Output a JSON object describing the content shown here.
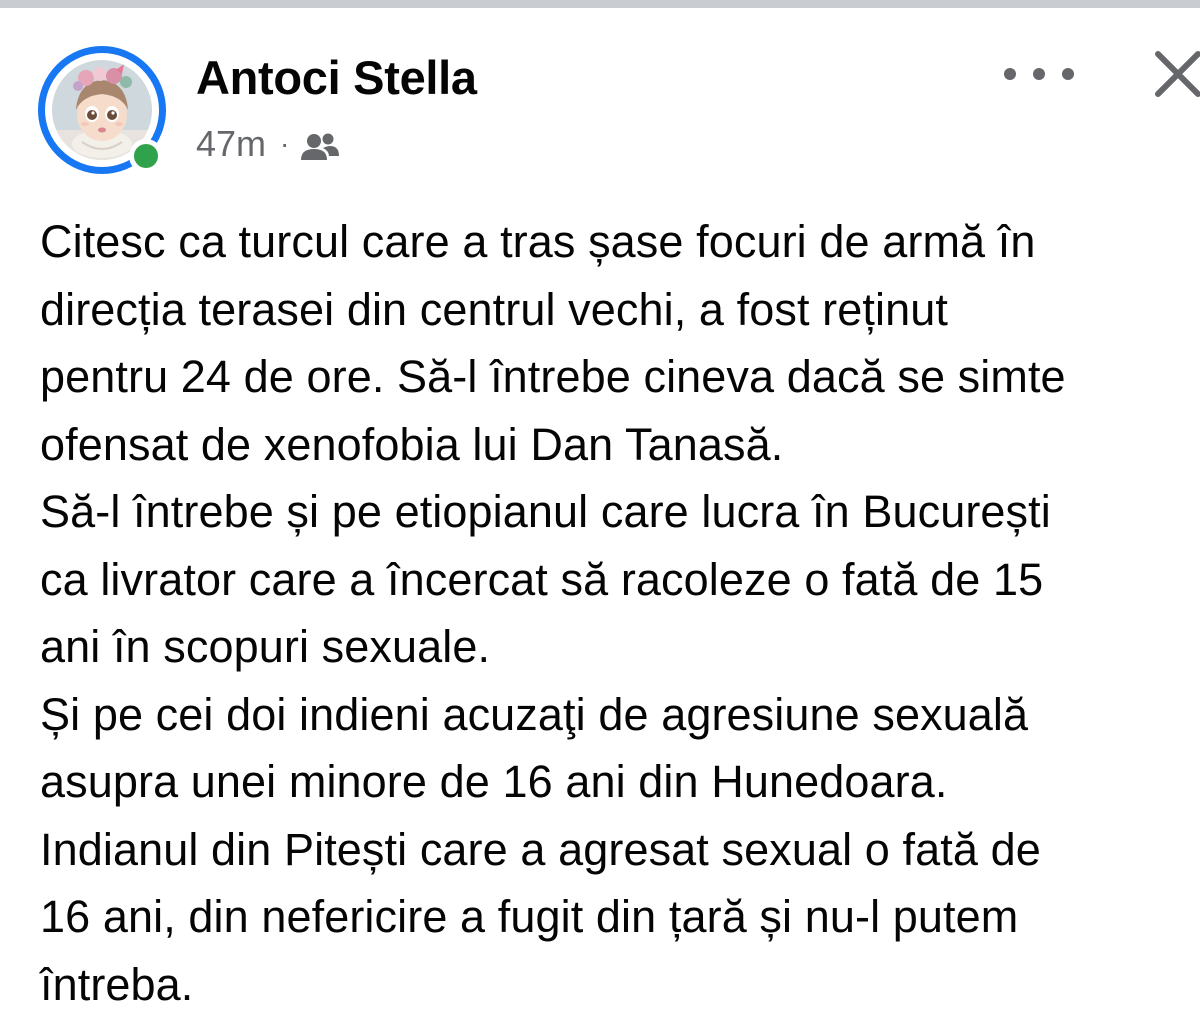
{
  "post": {
    "author_name": "Antoci Stella",
    "timestamp": "47m",
    "separator": "·",
    "audience_icon": "friends-icon",
    "more_icon": "more-horizontal-icon",
    "close_icon": "close-icon",
    "online_status_color": "#31a24c",
    "story_ring_color": "#1877f2",
    "body_lines": [
      "Citesc ca turcul care a tras șase focuri de armă în",
      "direcția terasei din centrul vechi, a fost reținut",
      "pentru 24 de ore. Să-l întrebe cineva dacă se simte",
      "ofensat de xenofobia lui Dan Tanasă.",
      "Să-l întrebe și pe etiopianul care lucra în București",
      "ca livrator care a încercat să racoleze o fată de 15",
      "ani în scopuri sexuale.",
      "Și pe cei doi indieni acuzaţi de agresiune sexuală",
      "asupra unei minore de 16 ani din Hunedoara.",
      "Indianul din Pitești care a agresat sexual o fată de",
      "16 ani, din nefericire a fugit din țară și nu-l putem",
      "întreba."
    ]
  }
}
